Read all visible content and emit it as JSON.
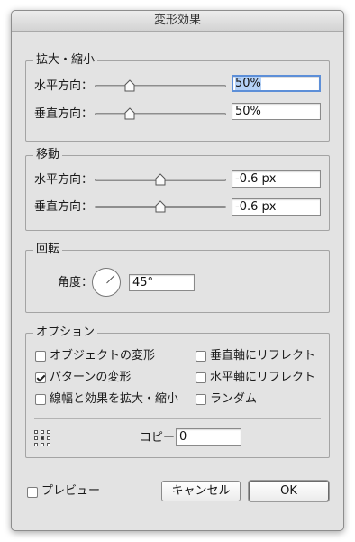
{
  "window": {
    "title": "変形効果"
  },
  "scale": {
    "legend": "拡大・縮小",
    "horizontal_label": "水平方向：",
    "horizontal_value": "50%",
    "horizontal_level": 0.27,
    "vertical_label": "垂直方向：",
    "vertical_value": "50%",
    "vertical_level": 0.27
  },
  "move": {
    "legend": "移動",
    "horizontal_label": "水平方向：",
    "horizontal_value": "-0.6 px",
    "horizontal_level": 0.5,
    "vertical_label": "垂直方向：",
    "vertical_value": "-0.6 px",
    "vertical_level": 0.5
  },
  "rotate": {
    "legend": "回転",
    "angle_label": "角度：",
    "angle_value": "45°"
  },
  "options": {
    "legend": "オプション",
    "transform_objects": {
      "label": "オブジェクトの変形",
      "checked": false
    },
    "transform_patterns": {
      "label": "パターンの変形",
      "checked": true
    },
    "scale_strokes": {
      "label": "線幅と効果を拡大・縮小",
      "checked": false
    },
    "reflect_vertical": {
      "label": "垂直軸にリフレクト",
      "checked": false
    },
    "reflect_horizontal": {
      "label": "水平軸にリフレクト",
      "checked": false
    },
    "random": {
      "label": "ランダム",
      "checked": false
    },
    "copies_label": "コピー",
    "copies_value": "0",
    "reference_point_icon": "reference-point-grid-icon"
  },
  "footer": {
    "preview_label": "プレビュー",
    "preview_checked": false,
    "cancel_label": "キャンセル",
    "ok_label": "OK"
  },
  "colors": {
    "focus_ring": "#5d8fd8",
    "selection": "#b5d2f7",
    "dialog_background": "#e3e3e3"
  }
}
